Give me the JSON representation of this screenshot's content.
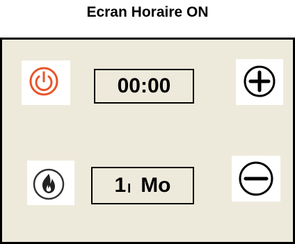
{
  "screen": {
    "title": "Ecran Horaire ON"
  },
  "display": {
    "time": "00:00",
    "program_number": "1",
    "program_separator": "I",
    "program_day": "Mo"
  },
  "icons": {
    "power": "power-icon",
    "plus": "plus-icon",
    "flame": "flame-icon",
    "minus": "minus-icon"
  },
  "colors": {
    "panel_background": "#eeeadb",
    "power_accent": "#e8542a",
    "border": "#000000"
  }
}
